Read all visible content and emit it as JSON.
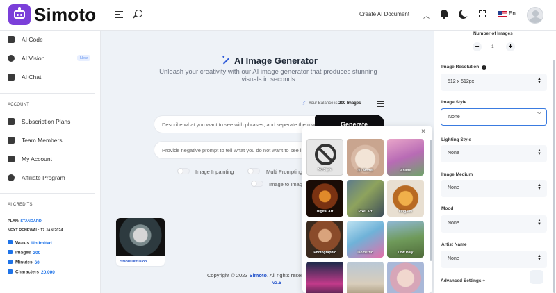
{
  "app": {
    "brand": "Simoto",
    "colors": {
      "accent": "#1e73e8",
      "logo": "#7b3fd9",
      "primary_button": "#0d0d10"
    }
  },
  "header": {
    "create_doc_label": "Create AI Document",
    "language": "En"
  },
  "sidebar": {
    "top_items": [
      {
        "label": "AI Code",
        "icon": "code-icon"
      },
      {
        "label": "AI Vision",
        "icon": "globe-icon",
        "badge": "New"
      },
      {
        "label": "AI Chat",
        "icon": "chat-icon"
      }
    ],
    "account_title": "ACCOUNT",
    "account_items": [
      {
        "label": "Subscription Plans",
        "icon": "plans-icon"
      },
      {
        "label": "Team Members",
        "icon": "team-icon"
      },
      {
        "label": "My Account",
        "icon": "account-icon"
      },
      {
        "label": "Affiliate Program",
        "icon": "dollar-icon"
      }
    ],
    "credits_title": "AI CREDITS",
    "plan_label": "PLAN:",
    "plan_value": "STANDARD",
    "renewal_label": "NEXT RENEWAL:",
    "renewal_value": "17 JAN 2024",
    "credits": [
      {
        "label": "Words",
        "value": "Unlimited"
      },
      {
        "label": "Images",
        "value": "200"
      },
      {
        "label": "Minutes",
        "value": "60"
      },
      {
        "label": "Characters",
        "value": "20,000"
      }
    ]
  },
  "main": {
    "title": "AI Image Generator",
    "subtitle": "Unleash your creativity with our AI image generator that produces stunning visuals in seconds",
    "balance_prefix": "Your Balance is",
    "balance_value": "200 Images",
    "prompt_placeholder": "Describe what you want to see with phrases, and seperate them with commas",
    "negative_placeholder": "Provide negative prompt to tell what you do not want to see in the image",
    "generate_label": "Generate",
    "toggles": [
      "Image Inpainting",
      "Multi Prompting",
      "Image to Image"
    ],
    "recent_card_label": "Stable Diffusion",
    "copyright_prefix": "Copyright © 2023",
    "copyright_brand": "Simoto",
    "copyright_suffix": ". All rights reserved",
    "version": "v3.5"
  },
  "style_popup": {
    "close": "×",
    "styles": [
      "No Style",
      "3D Model",
      "Anime",
      "Digital Art",
      "Pixel Art",
      "Origami",
      "Photographic",
      "Isometric",
      "Low Poly",
      "",
      "",
      ""
    ]
  },
  "right_panel": {
    "num_images_label": "Number of Images",
    "num_images_value": "1",
    "minus": "−",
    "plus": "+",
    "resolution_label": "Image Resolution",
    "resolution_value": "512 x 512px",
    "style_label": "Image Style",
    "style_value": "None",
    "lighting_label": "Lighting Style",
    "lighting_value": "None",
    "medium_label": "Image Medium",
    "medium_value": "None",
    "mood_label": "Mood",
    "mood_value": "None",
    "artist_label": "Artist Name",
    "artist_value": "None",
    "advanced_label": "Advanced Settings +"
  }
}
